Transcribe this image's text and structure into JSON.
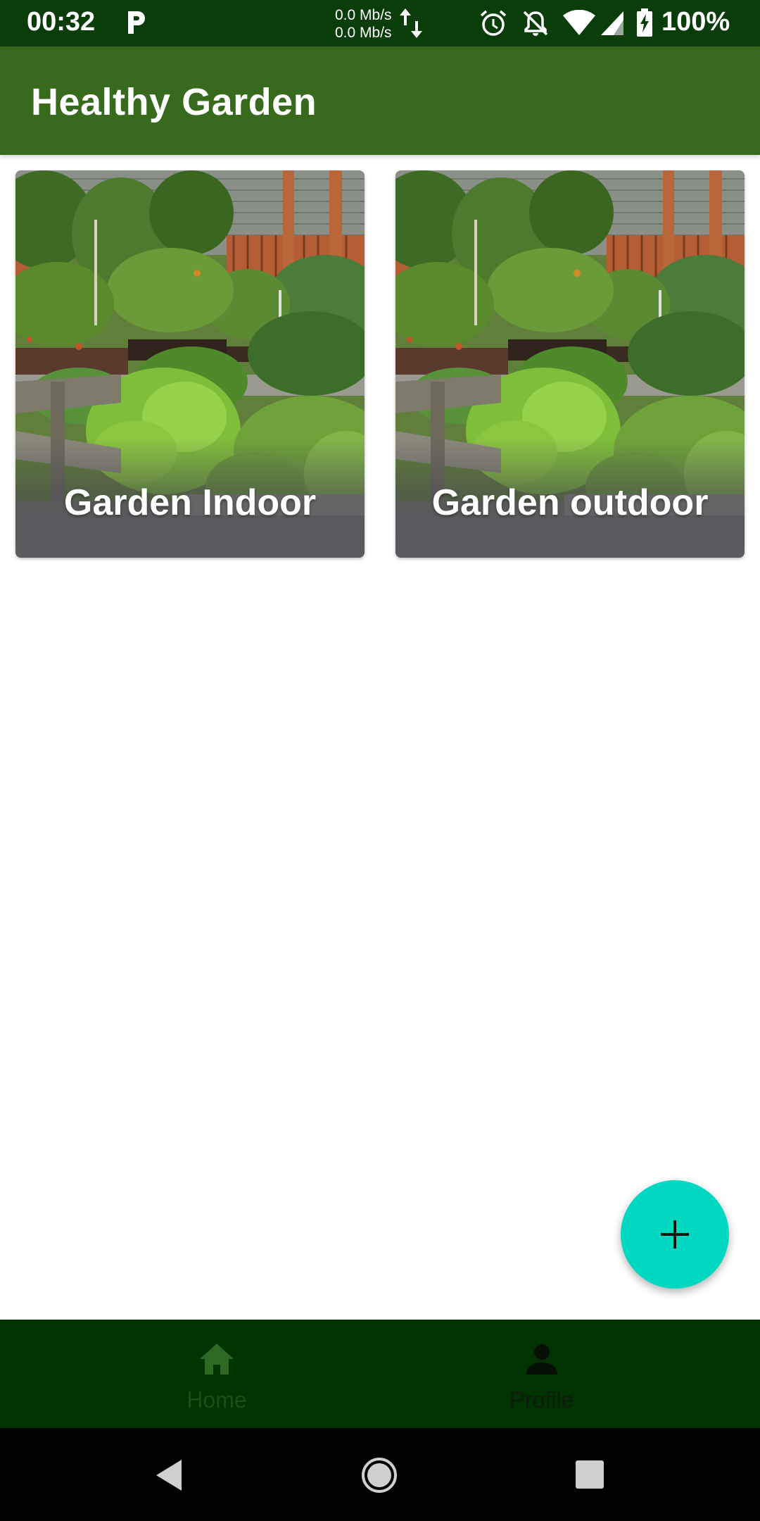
{
  "status_bar": {
    "time": "00:32",
    "net_up": "0.0 Mb/s",
    "net_down": "0.0 Mb/s",
    "battery": "100%",
    "icons": [
      "parking-icon",
      "network-arrows-icon",
      "alarm-icon",
      "bell-off-icon",
      "wifi-icon",
      "signal-icon",
      "battery-charging-icon"
    ]
  },
  "app_bar": {
    "title": "Healthy Garden"
  },
  "gardens": [
    {
      "label": "Garden Indoor",
      "image": "garden-photo"
    },
    {
      "label": "Garden outdoor",
      "image": "garden-photo"
    }
  ],
  "fab": {
    "icon": "plus-icon"
  },
  "bottom_nav": {
    "items": [
      {
        "label": "Home",
        "icon": "home-icon"
      },
      {
        "label": "Profile",
        "icon": "person-icon"
      }
    ]
  },
  "system_nav": {
    "icons": [
      "back-icon",
      "home-circle-icon",
      "recents-icon"
    ]
  },
  "colors": {
    "status_bar": "#0b3d0b",
    "app_bar": "#376a1d",
    "fab": "#00d8c2",
    "bottom_nav": "#003300",
    "system_nav": "#000000"
  }
}
